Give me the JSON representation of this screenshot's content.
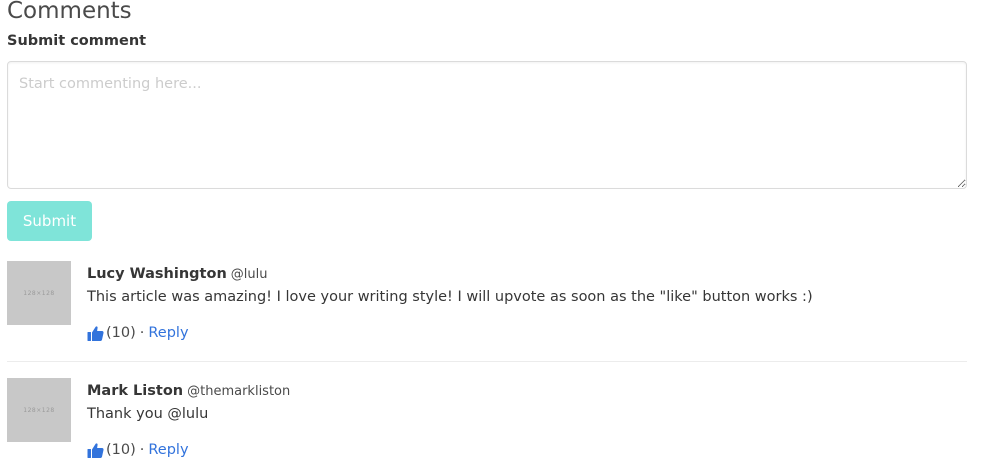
{
  "page": {
    "title": "Comments",
    "form_label": "Submit comment",
    "textarea_placeholder": "Start commenting here...",
    "textarea_value": "",
    "submit_label": "Submit"
  },
  "colors": {
    "accent": "#7fe4d9",
    "link": "#3273dc"
  },
  "comments": [
    {
      "avatar_text": "128×128",
      "author": "Lucy Washington",
      "handle": "@lulu",
      "body": "This article was amazing! I love your writing style! I will upvote as soon as the \"like\" button works :)",
      "likes": "(10)",
      "separator": "·",
      "reply_label": "Reply",
      "like_icon": "thumbs-up-icon"
    },
    {
      "avatar_text": "128×128",
      "author": "Mark Liston",
      "handle": "@themarkliston",
      "body": "Thank you @lulu",
      "likes": "(10)",
      "separator": "·",
      "reply_label": "Reply",
      "like_icon": "thumbs-up-icon"
    }
  ]
}
